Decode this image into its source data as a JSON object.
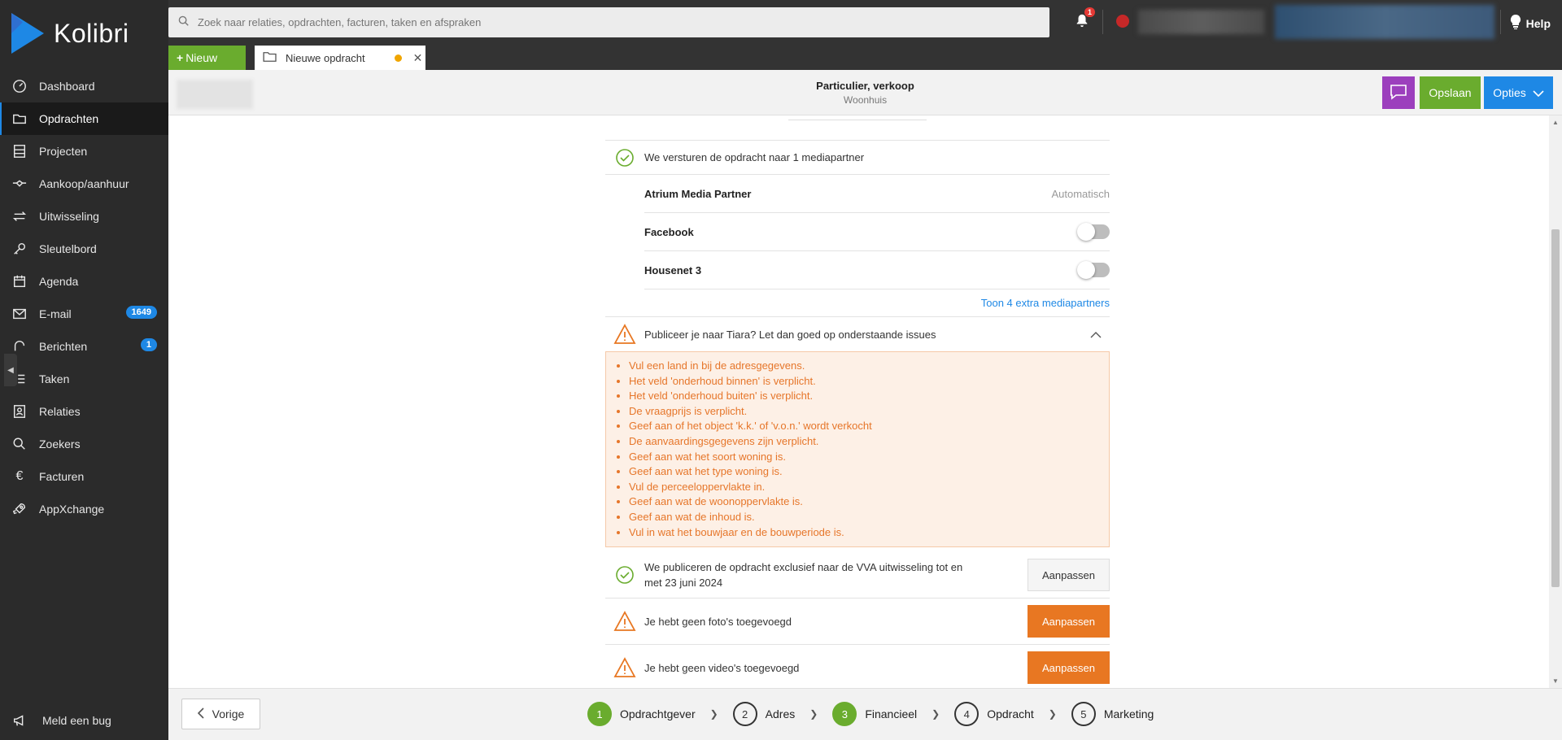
{
  "app": {
    "name": "Kolibri"
  },
  "sidebar": {
    "items": [
      {
        "label": "Dashboard",
        "icon": "dashboard-icon"
      },
      {
        "label": "Opdrachten",
        "icon": "folder-icon",
        "active": true
      },
      {
        "label": "Projecten",
        "icon": "projects-icon"
      },
      {
        "label": "Aankoop/aanhuur",
        "icon": "handshake-icon"
      },
      {
        "label": "Uitwisseling",
        "icon": "exchange-icon"
      },
      {
        "label": "Sleutelbord",
        "icon": "key-icon"
      },
      {
        "label": "Agenda",
        "icon": "calendar-icon"
      },
      {
        "label": "E-mail",
        "icon": "mail-icon",
        "badge": "1649"
      },
      {
        "label": "Berichten",
        "icon": "messages-icon",
        "badge": "1"
      },
      {
        "label": "Taken",
        "icon": "tasks-icon"
      },
      {
        "label": "Relaties",
        "icon": "contacts-icon"
      },
      {
        "label": "Zoekers",
        "icon": "search-icon"
      },
      {
        "label": "Facturen",
        "icon": "euro-icon"
      },
      {
        "label": "AppXchange",
        "icon": "rocket-icon"
      }
    ],
    "bug_label": "Meld een bug"
  },
  "topbar": {
    "search_placeholder": "Zoek naar relaties, opdrachten, facturen, taken en afspraken",
    "notifications_count": "1",
    "help_label": "Help"
  },
  "tabs": {
    "new_label": "Nieuw",
    "open_tab_label": "Nieuwe opdracht"
  },
  "header": {
    "title": "Particulier, verkoop",
    "subtitle": "Woonhuis",
    "save_label": "Opslaan",
    "options_label": "Opties"
  },
  "media": {
    "summary": "We versturen de opdracht naar 1 mediapartner",
    "partners": [
      {
        "name": "Atrium Media Partner",
        "status": "Automatisch"
      },
      {
        "name": "Facebook",
        "enabled": false
      },
      {
        "name": "Housenet 3",
        "enabled": false
      }
    ],
    "more_link": "Toon 4 extra mediapartners"
  },
  "tiara": {
    "warning": "Publiceer je naar Tiara? Let dan goed op onderstaande issues",
    "issues": [
      "Vul een land in bij de adresgegevens.",
      "Het veld 'onderhoud binnen' is verplicht.",
      "Het veld 'onderhoud buiten' is verplicht.",
      "De vraagprijs is verplicht.",
      "Geef aan of het object 'k.k.' of 'v.o.n.' wordt verkocht",
      "De aanvaardingsgegevens zijn verplicht.",
      "Geef aan wat het soort woning is.",
      "Geef aan wat het type woning is.",
      "Vul de perceeloppervlakte in.",
      "Geef aan wat de woonoppervlakte is.",
      "Geef aan wat de inhoud is.",
      "Vul in wat het bouwjaar en de bouwperiode is."
    ]
  },
  "actions": [
    {
      "text": "We publiceren de opdracht exclusief naar de VVA uitwisseling tot en met 23 juni 2024",
      "button": "Aanpassen",
      "status": "ok"
    },
    {
      "text": "Je hebt geen foto's toegevoegd",
      "button": "Aanpassen",
      "status": "warning"
    },
    {
      "text": "Je hebt geen video's toegevoegd",
      "button": "Aanpassen",
      "status": "warning"
    }
  ],
  "footer": {
    "prev_label": "Vorige",
    "steps": [
      {
        "num": "1",
        "label": "Opdrachtgever",
        "done": true
      },
      {
        "num": "2",
        "label": "Adres",
        "done": false
      },
      {
        "num": "3",
        "label": "Financieel",
        "done": true
      },
      {
        "num": "4",
        "label": "Opdracht",
        "done": false
      },
      {
        "num": "5",
        "label": "Marketing",
        "done": false
      }
    ]
  },
  "colors": {
    "accent": "#1e88e5",
    "success": "#6aac2e",
    "warning": "#e87722",
    "chat": "#9c3fbd"
  }
}
